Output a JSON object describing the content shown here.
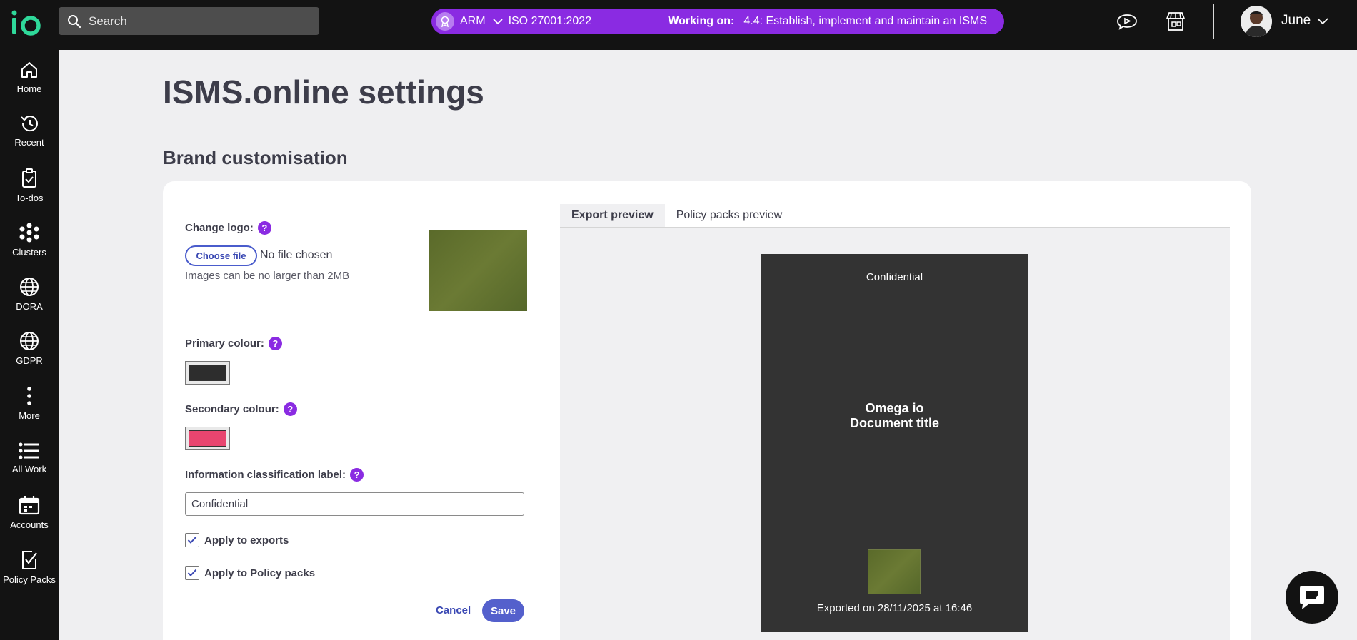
{
  "topbar": {
    "logo_text": "io",
    "search_placeholder": "Search",
    "context": {
      "org": "ARM",
      "standard": "ISO 27001:2022",
      "working_label": "Working on:",
      "working_task": "4.4: Establish, implement and maintain an ISMS"
    },
    "user_name": "June"
  },
  "sidenav": {
    "items": [
      {
        "label": "Home",
        "icon": "home-icon"
      },
      {
        "label": "Recent",
        "icon": "history-icon"
      },
      {
        "label": "To-dos",
        "icon": "clipboard-icon"
      },
      {
        "label": "Clusters",
        "icon": "clusters-icon"
      },
      {
        "label": "DORA",
        "icon": "globe-icon"
      },
      {
        "label": "GDPR",
        "icon": "globe-icon"
      },
      {
        "label": "More",
        "icon": "more-icon"
      },
      {
        "label": "All Work",
        "icon": "list-icon"
      },
      {
        "label": "Accounts",
        "icon": "calendar-icon"
      },
      {
        "label": "Policy Packs",
        "icon": "checklist-icon"
      }
    ]
  },
  "page": {
    "title": "ISMS.online settings",
    "section_title": "Brand customisation"
  },
  "form": {
    "logo_label": "Change logo:",
    "choose_file": "Choose file",
    "no_file": "No file chosen",
    "logo_hint": "Images can be no larger than 2MB",
    "primary_label": "Primary colour:",
    "primary_color": "#2d2d2d",
    "secondary_label": "Secondary colour:",
    "secondary_color": "#e8456f",
    "classification_label": "Information classification label:",
    "classification_value": "Confidential",
    "apply_exports": "Apply to exports",
    "apply_policy": "Apply to Policy packs",
    "cancel": "Cancel",
    "save": "Save"
  },
  "preview": {
    "tabs": [
      "Export preview",
      "Policy packs preview"
    ],
    "active_tab": 0,
    "doc_label": "Confidential",
    "doc_title_1": "Omega io",
    "doc_title_2": "Document title",
    "exported": "Exported on 28/11/2025 at 16:46"
  },
  "colors": {
    "accent": "#8a2be2",
    "button": "#5460cc",
    "link": "#3a48b3"
  }
}
